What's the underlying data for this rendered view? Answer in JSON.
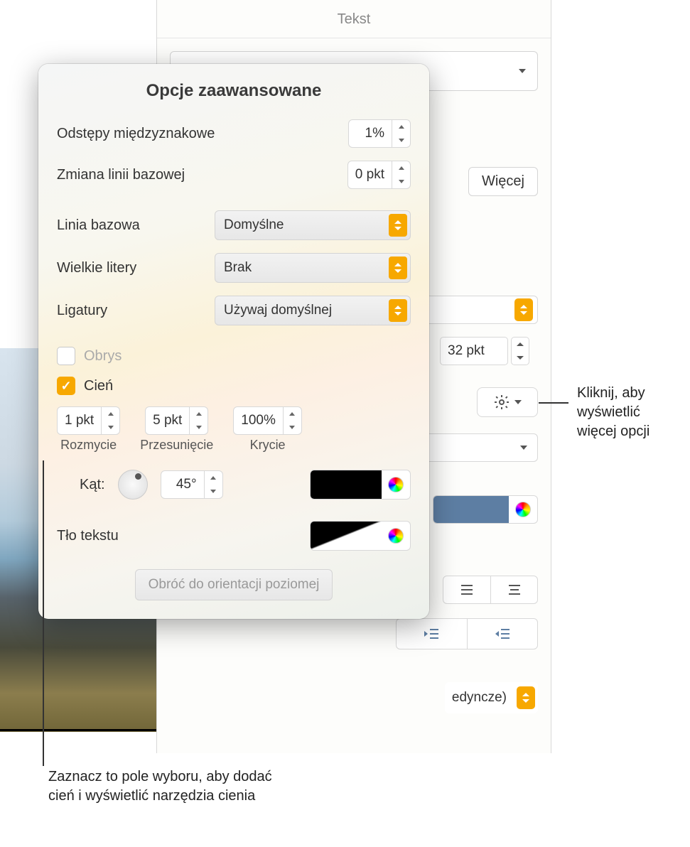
{
  "bg_panel": {
    "header": "Tekst",
    "more_btn": "Więcej",
    "font_size": "32 pkt",
    "spacing_value": "edyncze)"
  },
  "popover": {
    "title": "Opcje zaawansowane",
    "char_spacing": {
      "label": "Odstępy międzyznakowe",
      "value": "1%"
    },
    "baseline_shift": {
      "label": "Zmiana linii bazowej",
      "value": "0 pkt"
    },
    "baseline": {
      "label": "Linia bazowa",
      "value": "Domyślne"
    },
    "caps": {
      "label": "Wielkie litery",
      "value": "Brak"
    },
    "ligatures": {
      "label": "Ligatury",
      "value": "Używaj domyślnej"
    },
    "outline": {
      "label": "Obrys"
    },
    "shadow": {
      "label": "Cień",
      "blur": {
        "label": "Rozmycie",
        "value": "1 pkt"
      },
      "offset": {
        "label": "Przesunięcie",
        "value": "5 pkt"
      },
      "opacity": {
        "label": "Krycie",
        "value": "100%"
      },
      "angle": {
        "label": "Kąt:",
        "value": "45°"
      }
    },
    "text_bg": {
      "label": "Tło tekstu"
    },
    "rotate_btn": "Obróć do orientacji poziomej"
  },
  "callouts": {
    "gear": "Kliknij, aby wyświetlić więcej opcji",
    "shadow": "Zaznacz to pole wyboru, aby dodać cień i wyświetlić narzędzia cienia"
  }
}
